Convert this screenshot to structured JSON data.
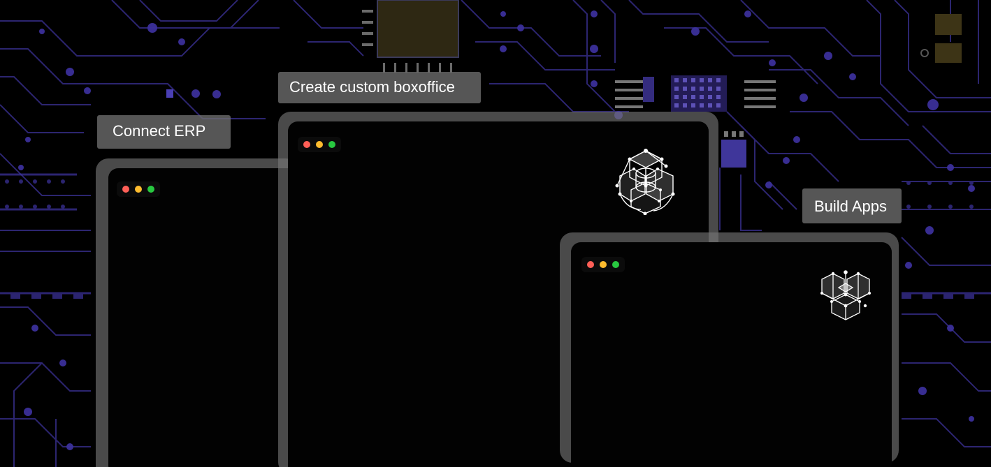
{
  "labels": {
    "erp": "Connect ERP",
    "boxoffice": "Create custom boxoffice",
    "apps": "Build Apps"
  },
  "icons": {
    "window_controls": [
      "red-dot-icon",
      "yellow-dot-icon",
      "green-dot-icon"
    ],
    "boxoffice_logo": "cube-network-icon",
    "apps_logo": "stacked-cubes-icon",
    "background": "circuit-board"
  },
  "colors": {
    "background": "#000000",
    "circuit": "#3a2f8f",
    "circuit_bright": "#5b4bd6",
    "frame": "#787878",
    "dot_red": "#ff5f57",
    "dot_yellow": "#febc2e",
    "dot_green": "#28c840"
  }
}
